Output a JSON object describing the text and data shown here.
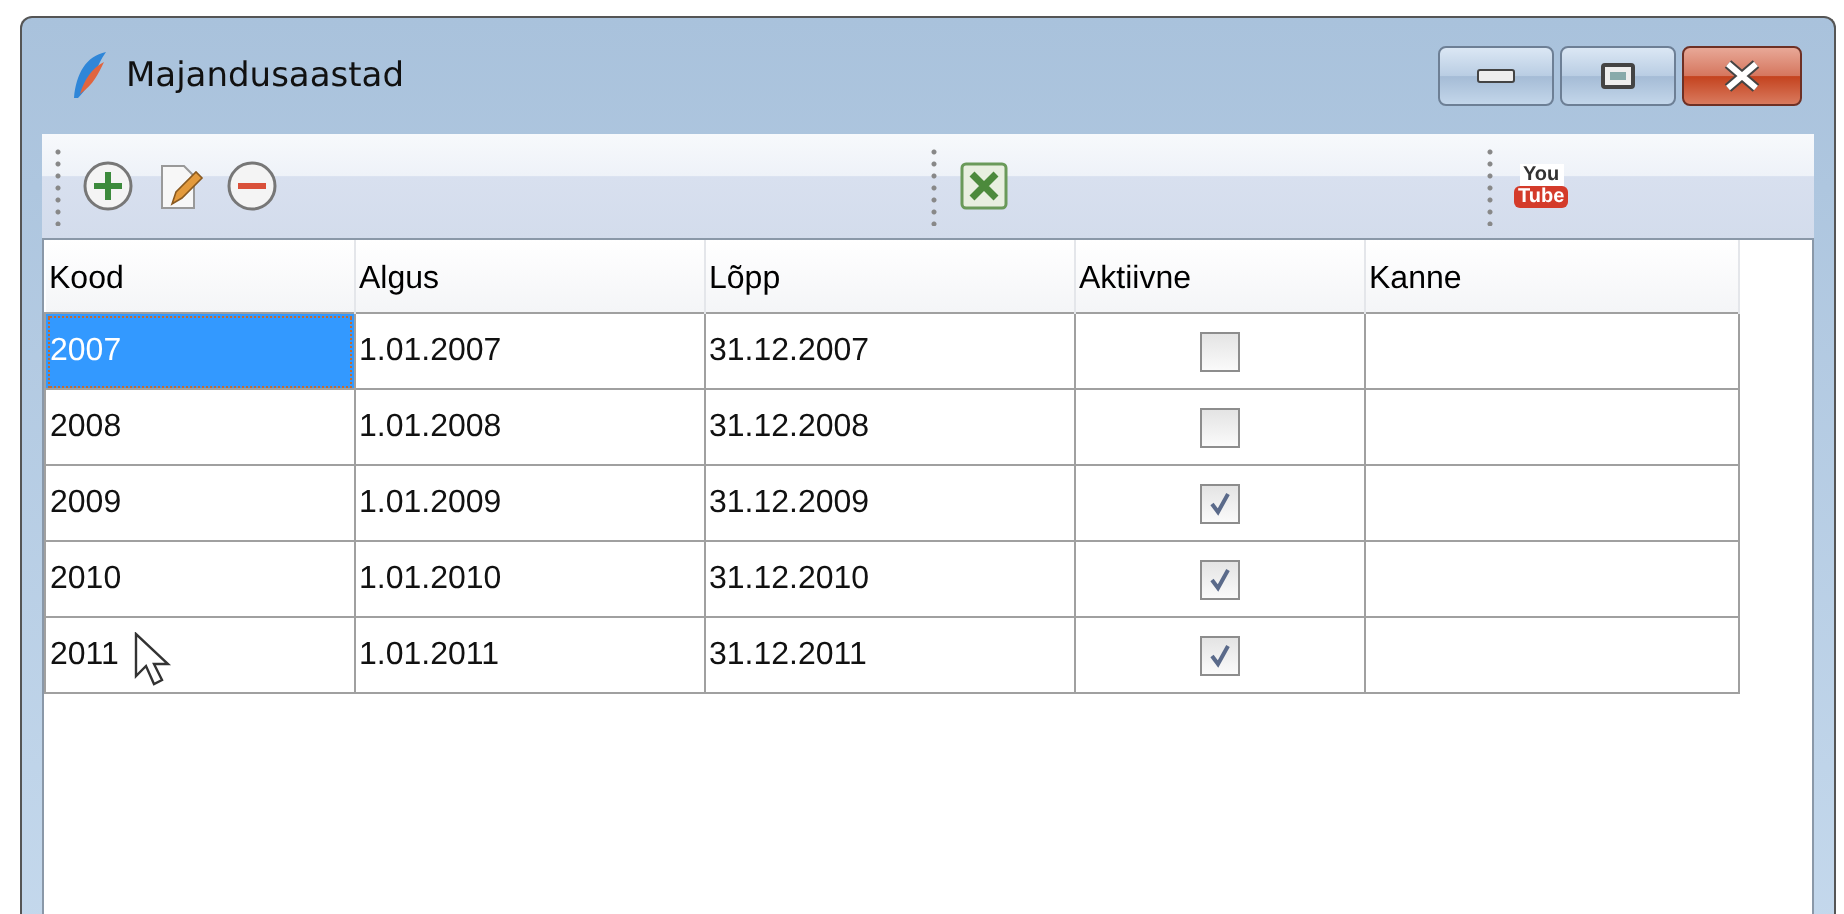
{
  "window": {
    "title": "Majandusaastad"
  },
  "toolbar": {
    "groups": [
      {
        "buttons": [
          {
            "kind": "add"
          },
          {
            "kind": "edit"
          },
          {
            "kind": "remove"
          }
        ]
      },
      {
        "buttons": [
          {
            "kind": "excel"
          }
        ]
      },
      {
        "buttons": [
          {
            "kind": "video",
            "top": "You",
            "bottom": "Tube"
          }
        ]
      }
    ]
  },
  "table": {
    "columns": [
      "Kood",
      "Algus",
      "Lõpp",
      "Aktiivne",
      "Kanne"
    ],
    "rows": [
      {
        "kood": "2007",
        "algus": "1.01.2007",
        "lopp": "31.12.2007",
        "aktiivne": false,
        "selected": true
      },
      {
        "kood": "2008",
        "algus": "1.01.2008",
        "lopp": "31.12.2008",
        "aktiivne": false,
        "selected": false
      },
      {
        "kood": "2009",
        "algus": "1.01.2009",
        "lopp": "31.12.2009",
        "aktiivne": true,
        "selected": false
      },
      {
        "kood": "2010",
        "algus": "1.01.2010",
        "lopp": "31.12.2010",
        "aktiivne": true,
        "selected": false
      },
      {
        "kood": "2011",
        "algus": "1.01.2011",
        "lopp": "31.12.2011",
        "aktiivne": true,
        "selected": false
      }
    ]
  }
}
